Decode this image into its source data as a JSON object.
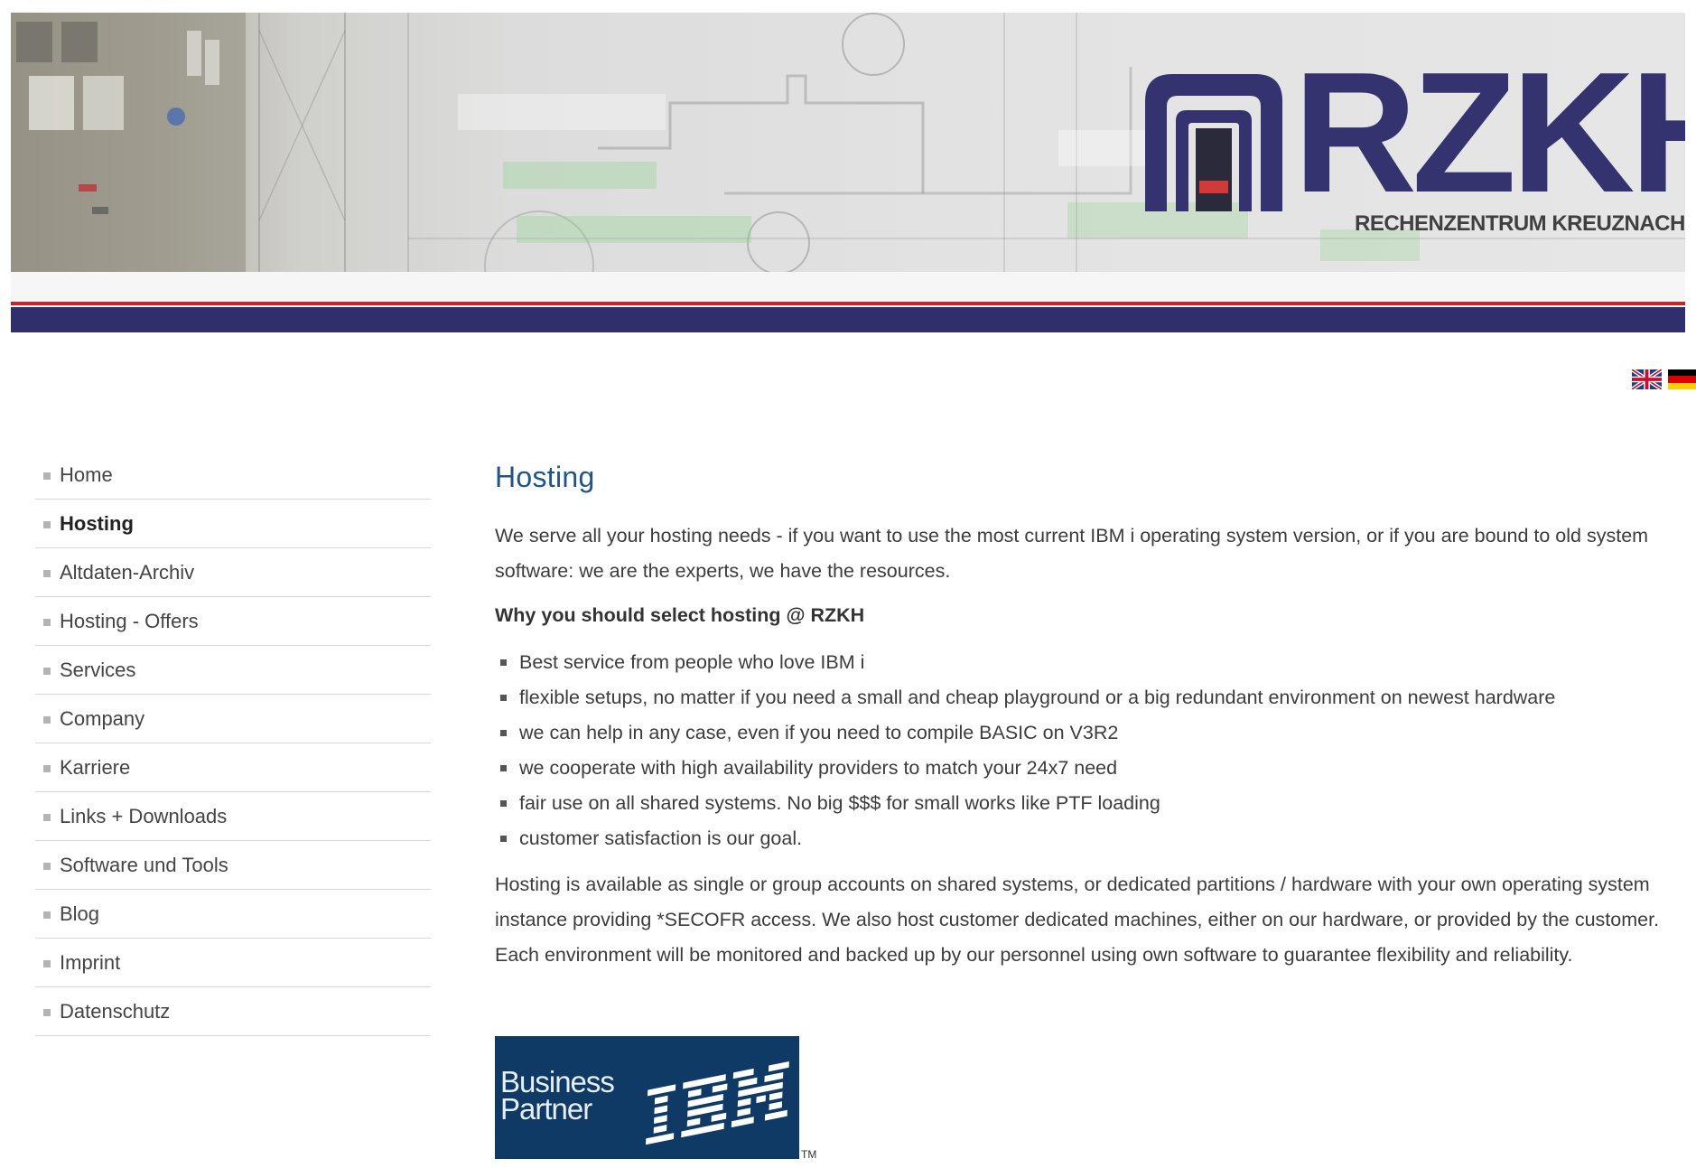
{
  "brand": {
    "logo_text": "RZKH",
    "logo_subtitle": "RECHENZENTRUM KREUZNACH",
    "color_navy": "#34336f",
    "color_red": "#c0272d"
  },
  "languages": [
    {
      "code": "en",
      "icon": "uk-flag-icon"
    },
    {
      "code": "de",
      "icon": "germany-flag-icon"
    }
  ],
  "sidebar": {
    "items": [
      {
        "label": "Home",
        "active": false
      },
      {
        "label": "Hosting",
        "active": true
      },
      {
        "label": "Altdaten-Archiv",
        "active": false
      },
      {
        "label": "Hosting - Offers",
        "active": false
      },
      {
        "label": "Services",
        "active": false
      },
      {
        "label": "Company",
        "active": false
      },
      {
        "label": "Karriere",
        "active": false
      },
      {
        "label": "Links + Downloads",
        "active": false
      },
      {
        "label": "Software und Tools",
        "active": false
      },
      {
        "label": "Blog",
        "active": false
      },
      {
        "label": "Imprint",
        "active": false
      },
      {
        "label": "Datenschutz",
        "active": false
      }
    ]
  },
  "main": {
    "title": "Hosting",
    "intro": "We serve all your hosting needs - if you want to use the most current IBM i operating system version, or if you are bound to old system software: we are the experts, we have the resources.",
    "why_heading": "Why you should select hosting @ RZKH",
    "bullets": [
      "Best service from people who love IBM i",
      "flexible setups, no matter if you need a small and cheap playground or a big redundant environment on newest hardware",
      "we can help in any case, even if you need to compile BASIC on V3R2",
      "we cooperate with high availability providers to match your 24x7 need",
      "fair use on all shared systems. No big $$$ for small works like PTF loading",
      "customer satisfaction is our goal."
    ],
    "closing": "Hosting is available as single or group accounts on shared systems, or dedicated partitions / hardware with your own operating system instance providing *SECOFR access. We also host customer dedicated machines, either on our hardware, or provided by the customer. Each environment will be monitored and backed up by our personnel using own software to guarantee flexibility and reliability."
  },
  "badge": {
    "line1": "Business",
    "line2": "Partner",
    "brand": "IBM",
    "trademark": "TM"
  }
}
